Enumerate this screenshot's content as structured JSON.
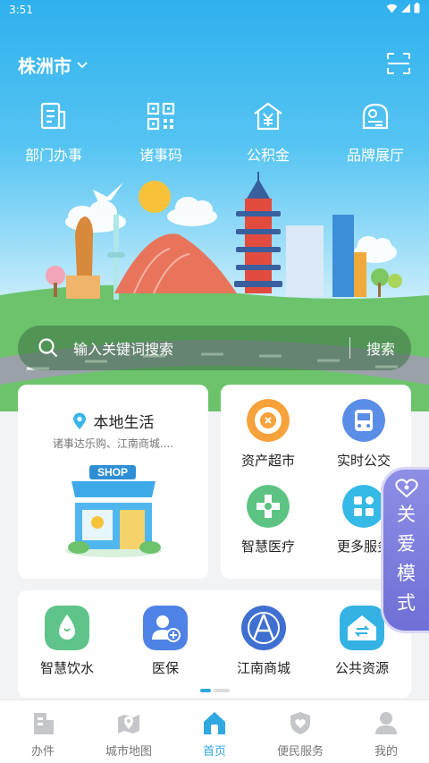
{
  "status_bar": {
    "time": "3:51"
  },
  "header": {
    "city": "株洲市"
  },
  "quick_nav": [
    {
      "label": "部门办事",
      "icon": "document-icon"
    },
    {
      "label": "诸事码",
      "icon": "qrcode-icon"
    },
    {
      "label": "公积金",
      "icon": "house-yen-icon"
    },
    {
      "label": "品牌展厅",
      "icon": "brand-hall-icon"
    }
  ],
  "search": {
    "placeholder": "输入关键词搜索",
    "button": "搜索"
  },
  "local_life": {
    "title": "本地生活",
    "subtitle": "诸事达乐购、江南商城....",
    "shop_sign": "SHOP"
  },
  "services": [
    {
      "label": "资产超市",
      "icon": "asset-market-icon"
    },
    {
      "label": "实时公交",
      "icon": "bus-icon"
    },
    {
      "label": "智慧医疗",
      "icon": "medical-icon"
    },
    {
      "label": "更多服务",
      "icon": "more-services-icon"
    }
  ],
  "care_mode": {
    "label": "关爱模式"
  },
  "apps": [
    {
      "label": "智慧饮水",
      "icon": "water-icon"
    },
    {
      "label": "医保",
      "icon": "medical-insurance-icon"
    },
    {
      "label": "江南商城",
      "icon": "mall-icon"
    },
    {
      "label": "公共资源",
      "icon": "public-resources-icon"
    }
  ],
  "tabs": [
    {
      "label": "办件",
      "icon": "building-icon"
    },
    {
      "label": "城市地图",
      "icon": "map-icon"
    },
    {
      "label": "首页",
      "icon": "home-icon"
    },
    {
      "label": "便民服务",
      "icon": "shield-icon"
    },
    {
      "label": "我的",
      "icon": "user-icon"
    }
  ],
  "colors": {
    "accent": "#2fa7e0",
    "care_mode": "#7b7bdc"
  }
}
